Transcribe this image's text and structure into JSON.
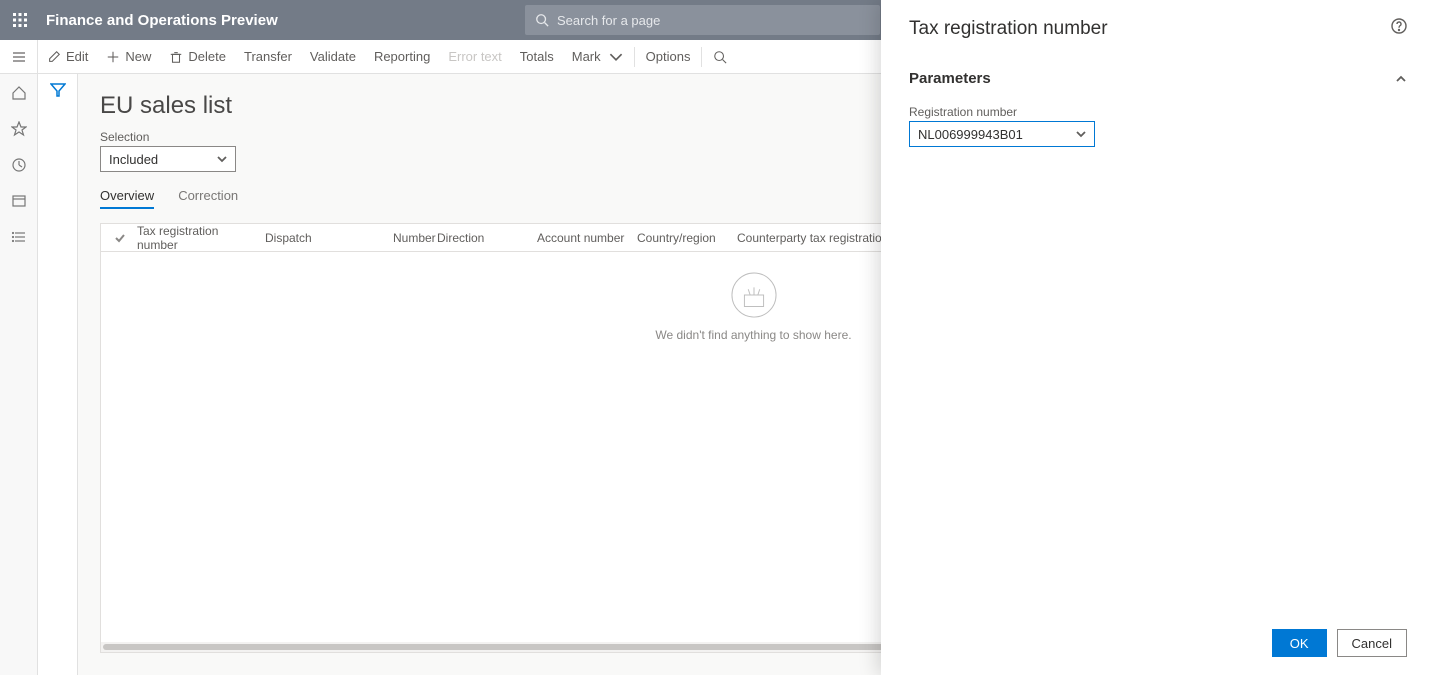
{
  "header": {
    "app_title": "Finance and Operations Preview",
    "search_placeholder": "Search for a page"
  },
  "actionbar": {
    "edit": "Edit",
    "new": "New",
    "delete": "Delete",
    "transfer": "Transfer",
    "validate": "Validate",
    "reporting": "Reporting",
    "error_text": "Error text",
    "totals": "Totals",
    "mark": "Mark",
    "options": "Options"
  },
  "page": {
    "title": "EU sales list",
    "selection_label": "Selection",
    "selection_value": "Included",
    "tabs": {
      "overview": "Overview",
      "correction": "Correction"
    },
    "columns": {
      "tax_reg": "Tax registration number",
      "dispatch": "Dispatch",
      "number": "Number",
      "direction": "Direction",
      "account": "Account number",
      "country": "Country/region",
      "counterparty": "Counterparty tax registration"
    },
    "empty_message": "We didn't find anything to show here."
  },
  "panel": {
    "title": "Tax registration number",
    "section": "Parameters",
    "field_label": "Registration number",
    "field_value": "NL006999943B01",
    "ok": "OK",
    "cancel": "Cancel"
  }
}
